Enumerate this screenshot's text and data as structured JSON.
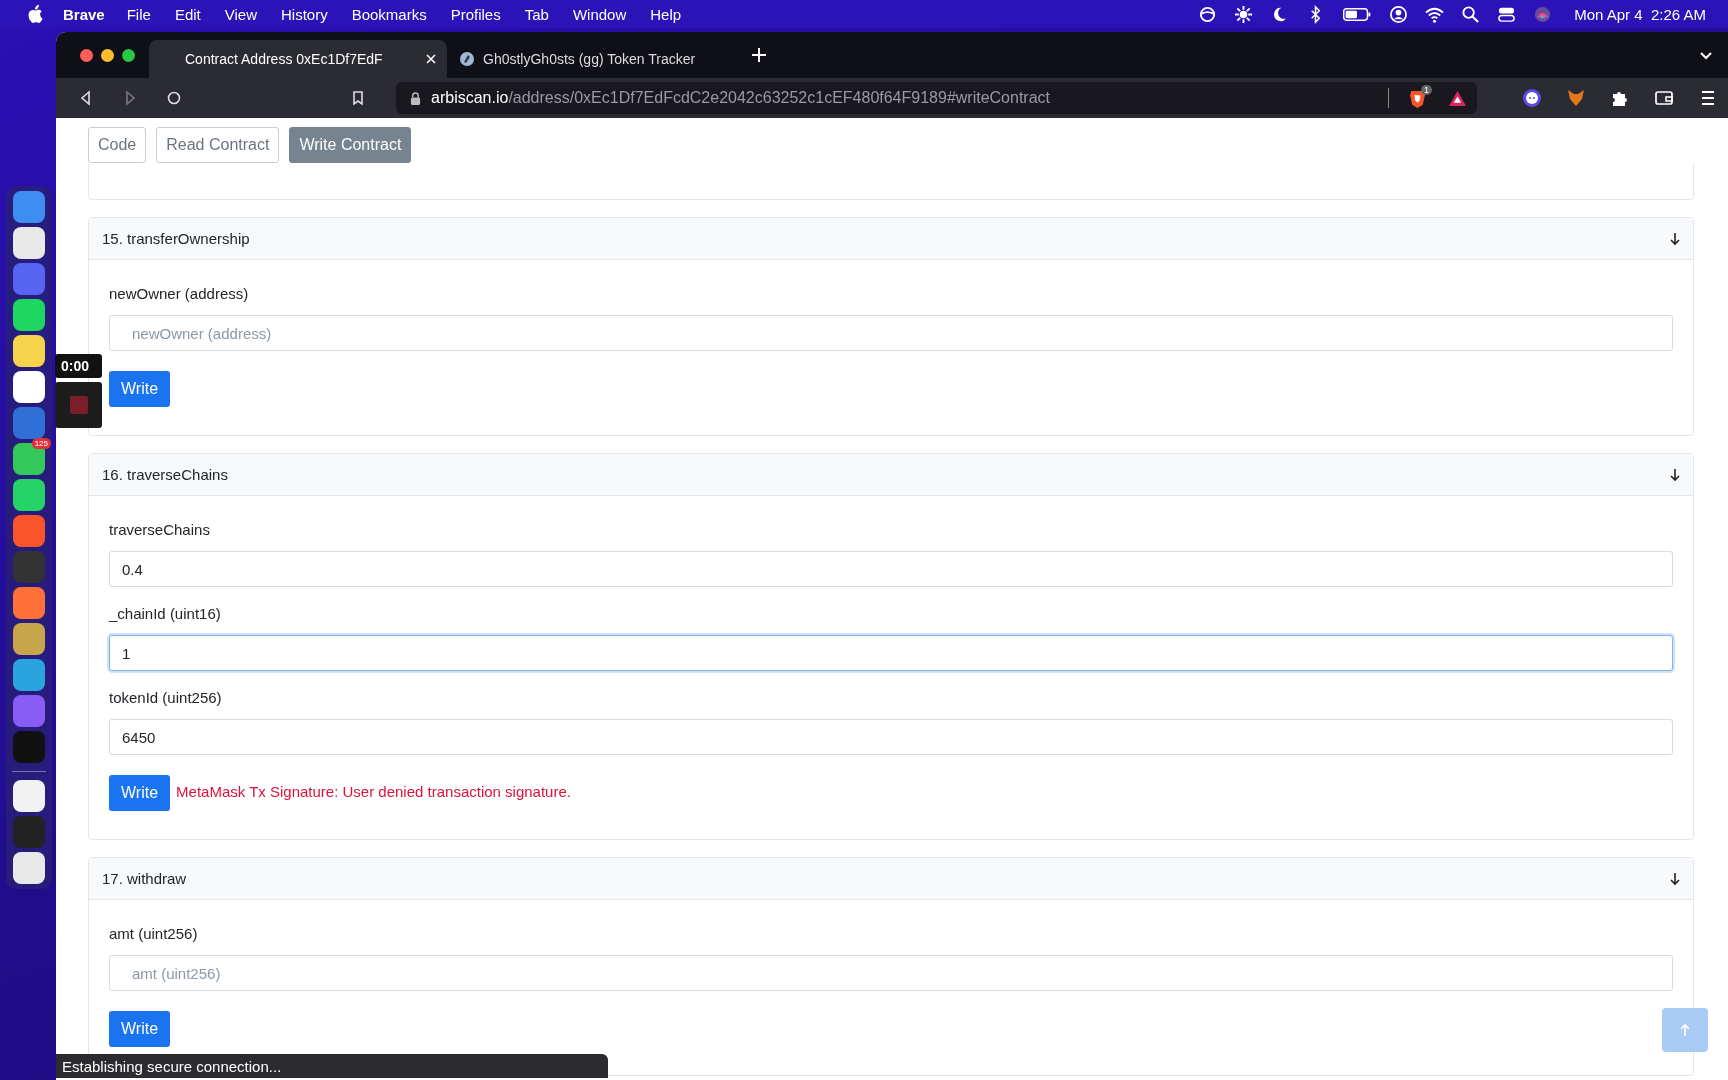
{
  "menu_bar": {
    "app": "Brave",
    "menus": [
      "File",
      "Edit",
      "View",
      "History",
      "Bookmarks",
      "Profiles",
      "Tab",
      "Window",
      "Help"
    ],
    "clock": "Mon Apr 4  2:26 AM"
  },
  "dock": {
    "items": [
      {
        "color": "#3d8ef0"
      },
      {
        "color": "#e9e9e9"
      },
      {
        "color": "#5865f2"
      },
      {
        "color": "#1ed760"
      },
      {
        "color": "#f5d34a"
      },
      {
        "color": "#ffffff"
      },
      {
        "color": "#2f6fd6"
      },
      {
        "color": "#34c759",
        "badge": "125"
      },
      {
        "color": "#25d366"
      },
      {
        "color": "#fb542b"
      },
      {
        "color": "#333333"
      },
      {
        "color": "#ff7139"
      },
      {
        "color": "#c7a54b"
      },
      {
        "color": "#2aa3df"
      },
      {
        "color": "#8a5cf6"
      },
      {
        "color": "#111111"
      }
    ],
    "recent": [
      {
        "color": "#f2f2f2"
      },
      {
        "color": "#222222"
      },
      {
        "color": "#e8e8e8"
      }
    ]
  },
  "recorder": {
    "time": "0:00"
  },
  "browser": {
    "tabs": [
      {
        "title": "Contract Address 0xEc1Df7EdF",
        "selected": true
      },
      {
        "title": "Gh0stlyGh0sts (gg) Token Tracker",
        "selected": false
      }
    ],
    "url": {
      "domain": "arbiscan.io",
      "path": "/address/0xEc1Df7EdFcdC2e2042c63252c1cEF480f64F9189#writeContract"
    },
    "shields_badge": "1"
  },
  "page": {
    "tabs": [
      {
        "label": "Code",
        "selected": false
      },
      {
        "label": "Read Contract",
        "selected": false
      },
      {
        "label": "Write Contract",
        "selected": true
      }
    ],
    "functions": [
      {
        "title": "15. transferOwnership",
        "fields": [
          {
            "label": "newOwner (address)",
            "placeholder": "newOwner (address)",
            "focused": false
          }
        ],
        "button": "Write"
      },
      {
        "title": "16. traverseChains",
        "fields": [
          {
            "label": "traverseChains",
            "value": "0.4",
            "focused": false
          },
          {
            "label": "_chainId (uint16)",
            "value": "1",
            "focused": true
          },
          {
            "label": "tokenId (uint256)",
            "value": "6450",
            "focused": false
          }
        ],
        "button": "Write",
        "error": "MetaMask Tx Signature: User denied transaction signature."
      },
      {
        "title": "17. withdraw",
        "fields": [
          {
            "label": "amt (uint256)",
            "placeholder": "amt (uint256)",
            "focused": false
          }
        ],
        "button": "Write"
      }
    ]
  },
  "status_bar": "Establishing secure connection..."
}
